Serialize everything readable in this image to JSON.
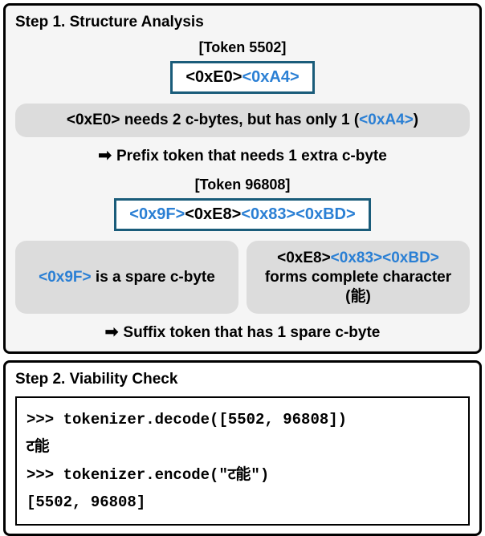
{
  "step1": {
    "title": "Step 1. Structure Analysis",
    "token1": {
      "label": "[Token 5502]",
      "byte1": "<0xE0>",
      "byte2": "<0xA4>"
    },
    "explain1_a": "<0xE0> needs 2 c-bytes, but has only 1 (",
    "explain1_b": "<0xA4>",
    "explain1_c": ")",
    "arrow1": "Prefix token that needs 1 extra c-byte",
    "token2": {
      "label": "[Token 96808]",
      "byte1": "<0x9F>",
      "byte2": "<0xE8>",
      "byte3": "<0x83>",
      "byte4": "<0xBD>"
    },
    "explain2a_a": "<0x9F>",
    "explain2a_b": " is a spare c-byte",
    "explain2b_a": "<0xE8>",
    "explain2b_b": "<0x83><0xBD>",
    "explain2b_c": " forms complete character (能)",
    "arrow2": "Suffix token that has 1 spare c-byte"
  },
  "step2": {
    "title": "Step 2. Viability Check",
    "code": {
      "l1": ">>> tokenizer.decode([5502, 96808])",
      "l2": "ट能",
      "l3": ">>> tokenizer.encode(\"ट能\")",
      "l4": "[5502, 96808]"
    }
  }
}
